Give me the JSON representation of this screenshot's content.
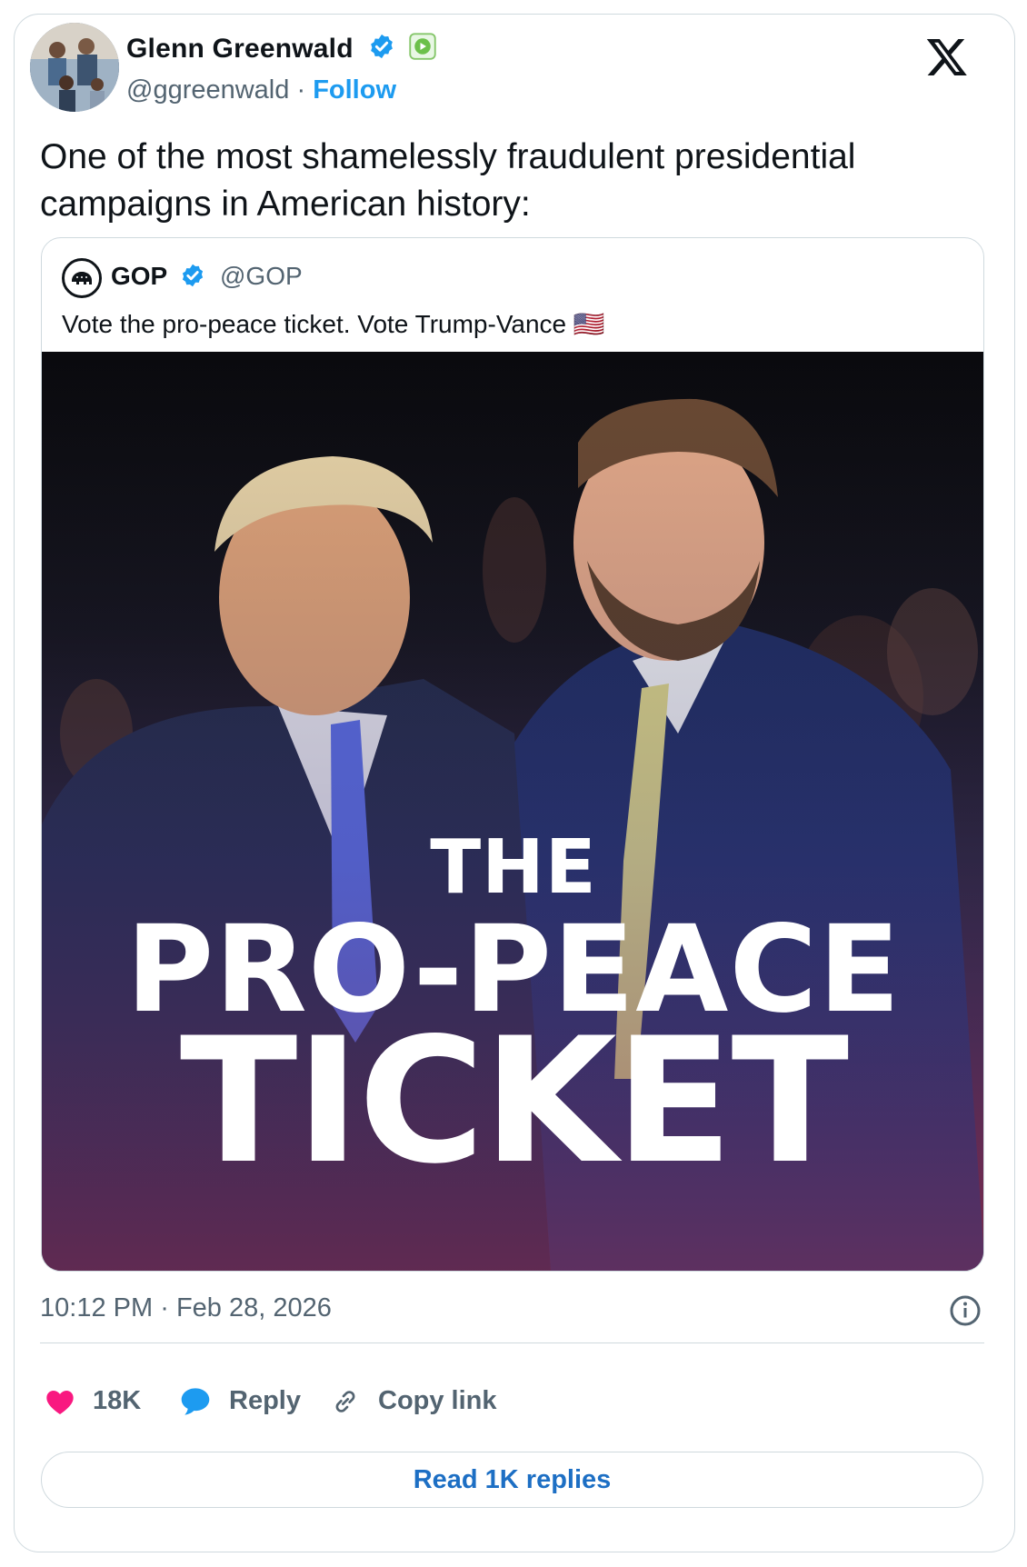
{
  "author": {
    "name": "Glenn Greenwald",
    "handle": "@ggreenwald",
    "separator": "·",
    "follow_label": "Follow",
    "verified_icon": "verified-badge-icon",
    "extra_badge_icon": "rumble-badge-icon"
  },
  "tweet": {
    "text": "One of the most shamelessly fraudulent presidential campaigns in American history:"
  },
  "quote": {
    "name": "GOP",
    "handle": "@GOP",
    "text": "Vote the pro-peace ticket. Vote Trump-Vance 🇺🇸",
    "image": {
      "line1": "THE",
      "line2": "PRO-PEACE",
      "line3": "TICKET"
    }
  },
  "meta": {
    "time": "10:12 PM",
    "separator": "·",
    "date": "Feb 28, 2026"
  },
  "actions": {
    "likes": "18K",
    "reply_label": "Reply",
    "copy_label": "Copy link"
  },
  "read_replies_label": "Read 1K replies",
  "colors": {
    "accent": "#1d9bf0",
    "like": "#f91880",
    "link_button": "#1d6fc4"
  }
}
